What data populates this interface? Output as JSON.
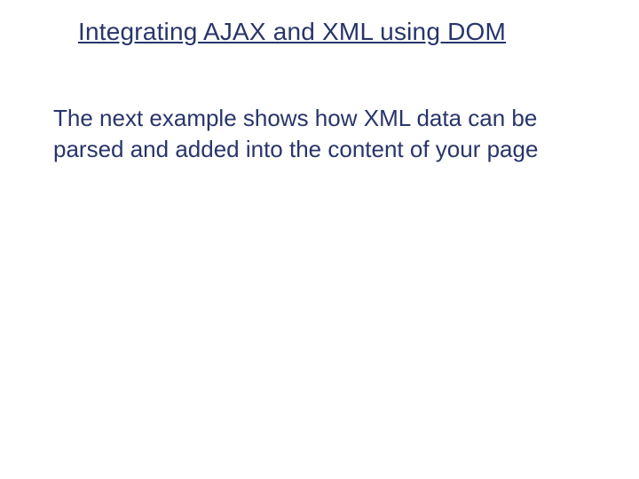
{
  "slide": {
    "title": "Integrating AJAX and XML using DOM",
    "body": "The next example shows how XML data can be parsed and added into the content of your page"
  }
}
